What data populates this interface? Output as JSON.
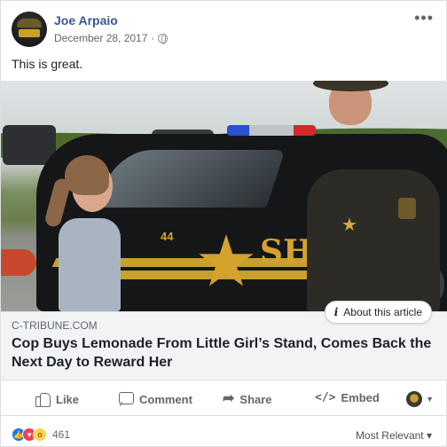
{
  "post": {
    "author": "Joe Arpaio",
    "date": "December 28, 2017",
    "separator": "·",
    "privacy_icon": "globe-icon",
    "more_icon": "•••",
    "status_text": "This is great."
  },
  "link": {
    "domain": "C-TRIBUNE.COM",
    "headline": "Cop Buys Lemonade From Little Girl’s Stand, Comes Back the Next Day to Reward Her",
    "about_label": "About this article",
    "about_icon": "i"
  },
  "photo": {
    "car_number": "44",
    "car_text": "SHE"
  },
  "actions": {
    "like": "Like",
    "comment": "Comment",
    "share": "Share",
    "embed": "Embed",
    "embed_icon": "</>"
  },
  "reactions": {
    "types": [
      "like",
      "love",
      "wow"
    ],
    "count": "461",
    "sort_label": "Most Relevant ▾"
  },
  "colors": {
    "link_blue": "#365899",
    "like_blue": "#1877f2",
    "love_red": "#f33e58",
    "wow_yellow": "#fdd34f",
    "badge_gold": "#d3a32e"
  }
}
